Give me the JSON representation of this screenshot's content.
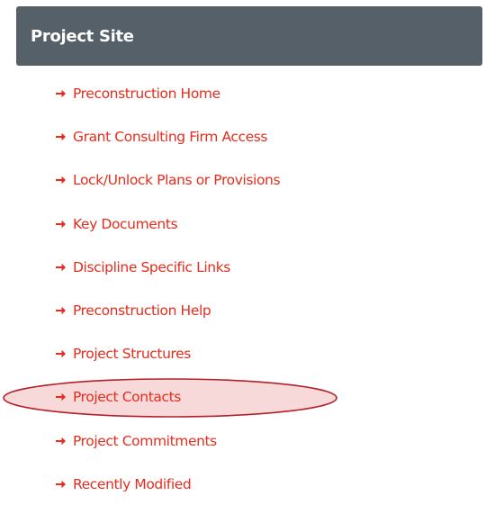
{
  "header": {
    "title": "Project Site"
  },
  "nav": {
    "items": [
      {
        "label": "Preconstruction Home",
        "highlighted": false
      },
      {
        "label": "Grant Consulting Firm Access",
        "highlighted": false
      },
      {
        "label": "Lock/Unlock Plans or Provisions",
        "highlighted": false
      },
      {
        "label": "Key Documents",
        "highlighted": false
      },
      {
        "label": "Discipline Specific Links",
        "highlighted": false
      },
      {
        "label": "Preconstruction Help",
        "highlighted": false
      },
      {
        "label": "Project Structures",
        "highlighted": false
      },
      {
        "label": "Project Contacts",
        "highlighted": true
      },
      {
        "label": "Project Commitments",
        "highlighted": false
      },
      {
        "label": "Recently Modified",
        "highlighted": false
      }
    ]
  },
  "colors": {
    "header_bg": "#556069",
    "header_text": "#ffffff",
    "link": "#e52d1d",
    "arrow": "#e52d1d",
    "highlight_stroke": "#b3202a",
    "highlight_fill": "#f7d9d9"
  },
  "icons": {
    "nav_bullet": "right-arrow-icon"
  }
}
